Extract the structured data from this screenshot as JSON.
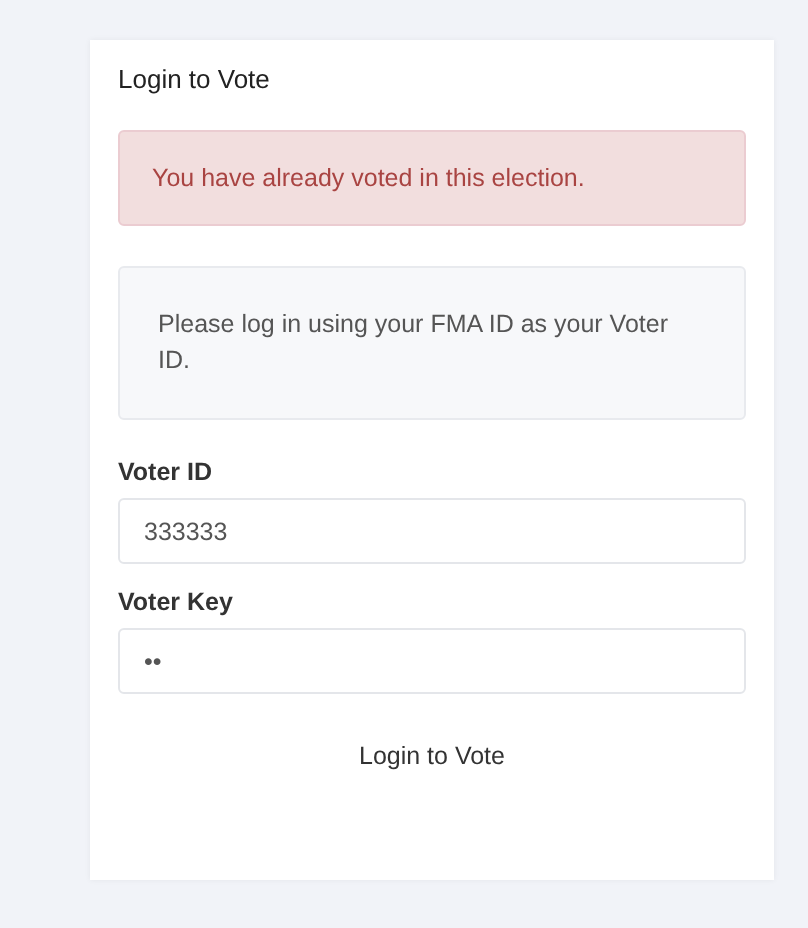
{
  "card": {
    "title": "Login to Vote",
    "alert": "You have already voted in this election.",
    "info": "Please log in using your FMA ID as your Voter ID.",
    "fields": [
      {
        "label": "Voter ID",
        "value": "333333"
      },
      {
        "label": "Voter Key",
        "value": "••"
      }
    ],
    "submit": "Login to Vote"
  }
}
